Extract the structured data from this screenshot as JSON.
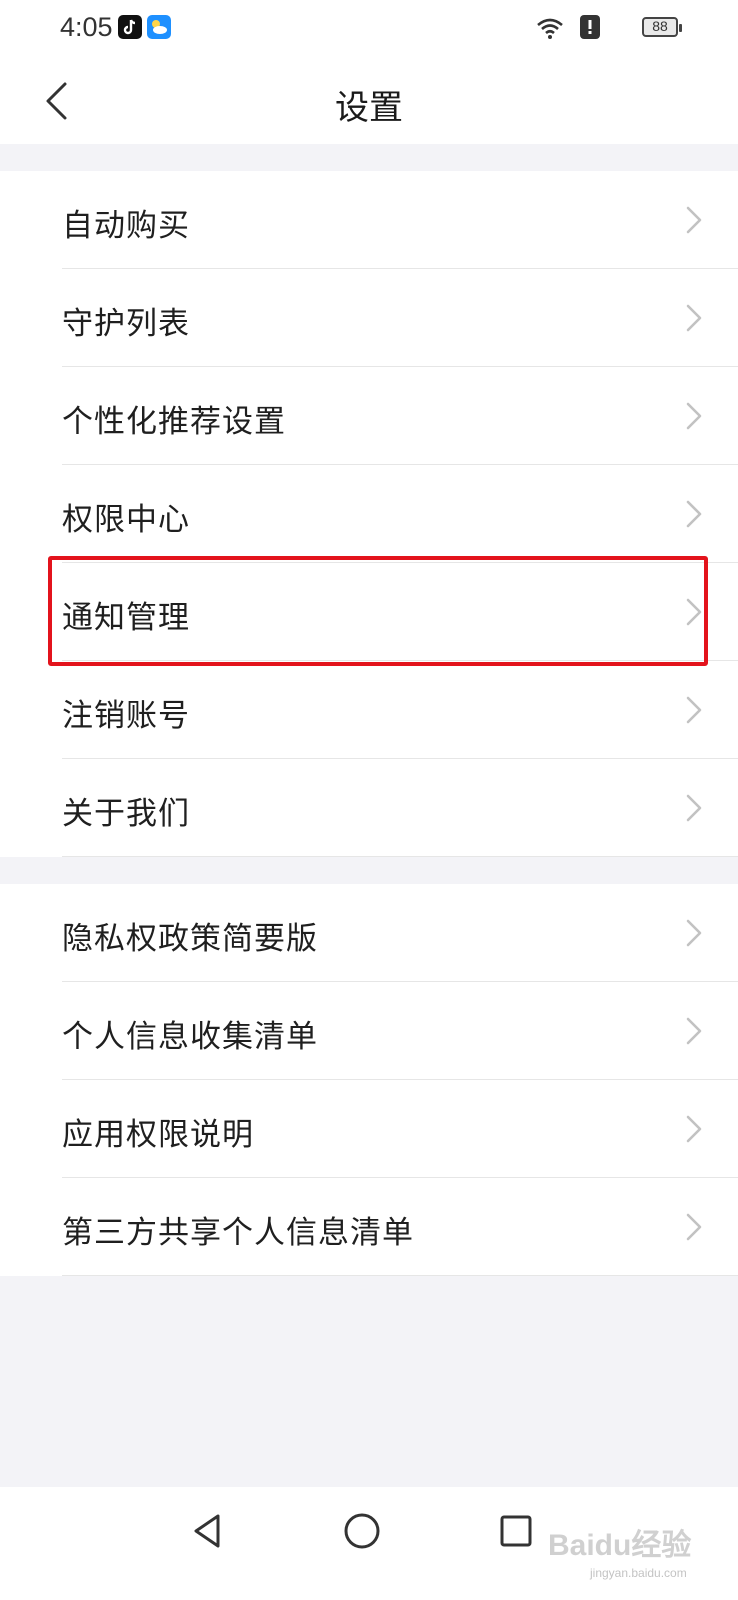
{
  "status_bar": {
    "time": "4:05",
    "battery": "88",
    "icons": [
      "tiktok-icon",
      "weather-icon",
      "wifi-icon",
      "alert-icon",
      "battery-icon"
    ]
  },
  "header": {
    "title": "设置",
    "back_icon": "chevron-left-icon"
  },
  "groups": [
    {
      "items": [
        {
          "label": "自动购买"
        },
        {
          "label": "守护列表"
        },
        {
          "label": "个性化推荐设置"
        },
        {
          "label": "权限中心"
        },
        {
          "label": "通知管理",
          "highlighted": true
        },
        {
          "label": "注销账号"
        },
        {
          "label": "关于我们"
        }
      ]
    },
    {
      "items": [
        {
          "label": "隐私权政策简要版"
        },
        {
          "label": "个人信息收集清单"
        },
        {
          "label": "应用权限说明"
        },
        {
          "label": "第三方共享个人信息清单"
        }
      ]
    }
  ],
  "nav_bar": {
    "buttons": [
      "back-triangle-icon",
      "home-circle-icon",
      "recents-square-icon"
    ]
  },
  "watermark": {
    "text": "Baidu经验",
    "sub": "jingyan.baidu.com"
  },
  "colors": {
    "highlight": "#e3131c",
    "background": "#f3f3f7"
  }
}
